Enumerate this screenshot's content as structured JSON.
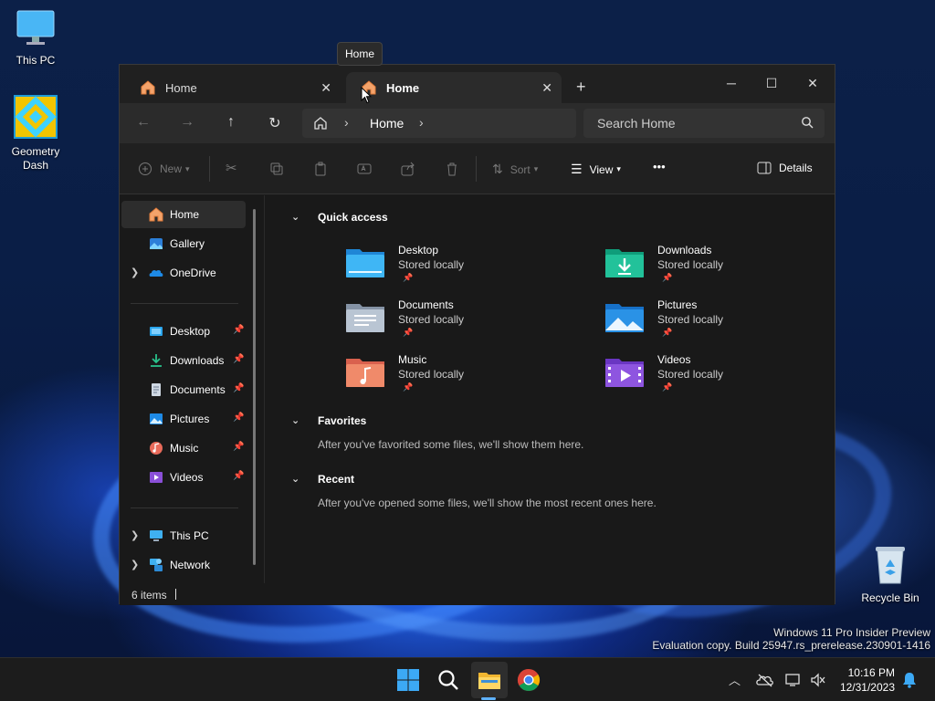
{
  "desktop": {
    "icons": [
      {
        "label": "This PC",
        "icon": "monitor-icon"
      },
      {
        "label": "Geometry Dash",
        "icon": "geometry-dash-icon"
      },
      {
        "label": "Recycle Bin",
        "icon": "recycle-bin-icon"
      }
    ],
    "watermark_line1": "Windows 11 Pro Insider Preview",
    "watermark_line2": "Evaluation copy. Build 25947.rs_prerelease.230901-1416"
  },
  "tooltip": "Home",
  "window": {
    "tabs": [
      {
        "label": "Home",
        "icon": "home-icon",
        "active": false
      },
      {
        "label": "Home",
        "icon": "home-icon",
        "active": true
      }
    ],
    "new_tab": "+",
    "controls": {
      "minimize": "─",
      "maximize": "☐",
      "close": "✕"
    },
    "nav": {
      "back": "←",
      "forward": "→",
      "up": "↑",
      "refresh": "↻"
    },
    "address": {
      "crumb": "Home"
    },
    "search": {
      "placeholder": "Search Home"
    },
    "commands": {
      "new": "New",
      "sort": "Sort",
      "view": "View",
      "more": "•••",
      "details": "Details"
    },
    "sidebar": {
      "top": [
        {
          "label": "Home",
          "icon": "home-icon"
        },
        {
          "label": "Gallery",
          "icon": "gallery-icon"
        },
        {
          "label": "OneDrive",
          "icon": "onedrive-icon"
        }
      ],
      "pinned": [
        {
          "label": "Desktop",
          "icon": "desktop-folder-icon"
        },
        {
          "label": "Downloads",
          "icon": "downloads-icon"
        },
        {
          "label": "Documents",
          "icon": "documents-icon"
        },
        {
          "label": "Pictures",
          "icon": "pictures-icon"
        },
        {
          "label": "Music",
          "icon": "music-icon"
        },
        {
          "label": "Videos",
          "icon": "videos-icon"
        }
      ],
      "bottom": [
        {
          "label": "This PC",
          "icon": "this-pc-icon"
        },
        {
          "label": "Network",
          "icon": "network-icon"
        }
      ]
    },
    "quick_access": {
      "title": "Quick access",
      "items": [
        {
          "name": "Desktop",
          "sub": "Stored locally"
        },
        {
          "name": "Downloads",
          "sub": "Stored locally"
        },
        {
          "name": "Documents",
          "sub": "Stored locally"
        },
        {
          "name": "Pictures",
          "sub": "Stored locally"
        },
        {
          "name": "Music",
          "sub": "Stored locally"
        },
        {
          "name": "Videos",
          "sub": "Stored locally"
        }
      ]
    },
    "favorites": {
      "title": "Favorites",
      "note": "After you've favorited some files, we'll show them here."
    },
    "recent": {
      "title": "Recent",
      "note": "After you've opened some files, we'll show the most recent ones here."
    },
    "status": {
      "count": "6 items"
    }
  },
  "taskbar": {
    "time": "10:16 PM",
    "date": "12/31/2023"
  }
}
